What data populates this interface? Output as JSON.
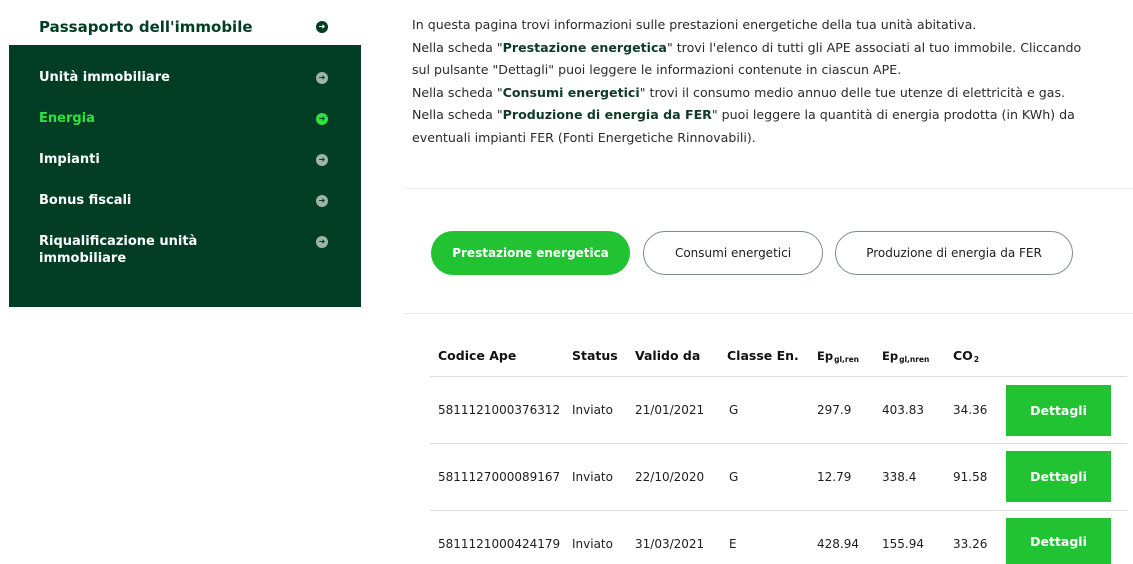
{
  "sidebar": {
    "header": "Passaporto dell'immobile",
    "items": [
      {
        "label": "Unità immobiliare"
      },
      {
        "label": "Energia"
      },
      {
        "label": "Impianti"
      },
      {
        "label": "Bonus fiscali"
      },
      {
        "label": "Riqualificazione unità immobiliare"
      }
    ],
    "active_item": "Energia",
    "arrow_glyph": "➜"
  },
  "intro": {
    "line1": "In questa pagina trovi informazioni sulle prestazioni energetiche della tua unità abitativa.",
    "line2_pre": "Nella scheda \"",
    "line2_bold": "Prestazione energetica",
    "line2_post": "\" trovi l'elenco di tutti gli APE associati al tuo immobile. Cliccando",
    "line3": "sul pulsante \"Dettagli\" puoi leggere le informazioni contenute in ciascun APE.",
    "line4_pre": "Nella scheda \"",
    "line4_bold": "Consumi energetici",
    "line4_post": "\" trovi il consumo medio annuo delle tue utenze di elettricità e gas.",
    "line5_pre": "Nella scheda \"",
    "line5_bold": "Produzione di energia da FER",
    "line5_post": "\" puoi leggere la quantità di energia prodotta (in KWh) da",
    "line6": "eventuali impianti FER (Fonti Energetiche Rinnovabili)."
  },
  "tabs": [
    {
      "label": "Prestazione energetica",
      "active": true
    },
    {
      "label": "Consumi energetici",
      "active": false
    },
    {
      "label": "Produzione di energia da FER",
      "active": false
    }
  ],
  "table": {
    "headers": {
      "codice": "Codice Ape",
      "status": "Status",
      "valido": "Valido da",
      "classe": "Classe En.",
      "ep_ren": "Ep",
      "ep_ren_sub": "gl,ren",
      "ep_nren": "Ep",
      "ep_nren_sub": "gl,nren",
      "co2": "CO",
      "co2_sub": "2"
    },
    "rows": [
      {
        "codice": "5811121000376312",
        "status": "Inviato",
        "valido": "21/01/2021",
        "classe": "G",
        "ep_ren": "297.9",
        "ep_nren": "403.83",
        "co2": "34.36",
        "button": "Dettagli"
      },
      {
        "codice": "5811127000089167",
        "status": "Inviato",
        "valido": "22/10/2020",
        "classe": "G",
        "ep_ren": "12.79",
        "ep_nren": "338.4",
        "co2": "91.58",
        "button": "Dettagli"
      },
      {
        "codice": "5811121000424179",
        "status": "Inviato",
        "valido": "31/03/2021",
        "classe": "E",
        "ep_ren": "428.94",
        "ep_nren": "155.94",
        "co2": "33.26",
        "button": "Dettagli"
      }
    ]
  },
  "colors": {
    "sidebar_bg": "#003d25",
    "accent_green": "#22c332",
    "active_text": "#2fe33f"
  }
}
